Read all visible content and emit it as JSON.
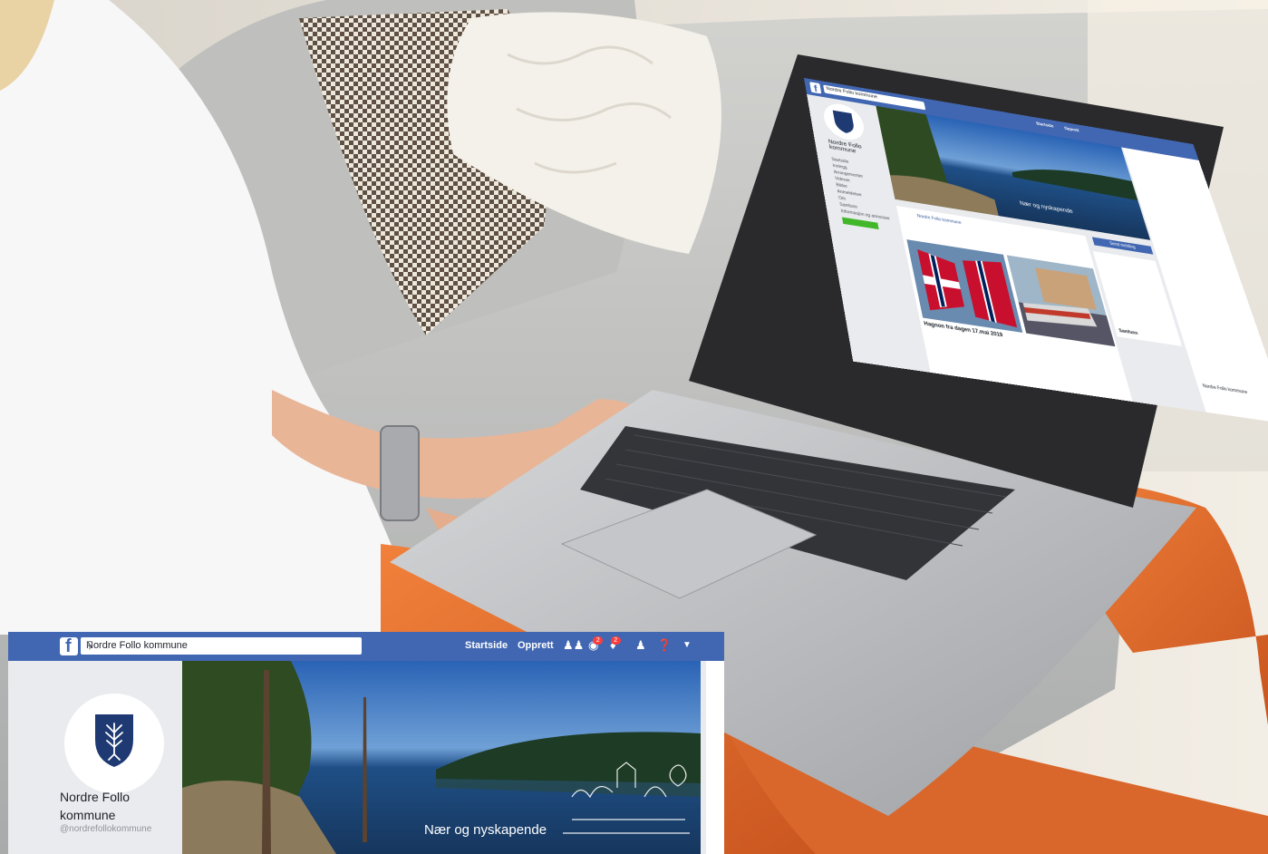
{
  "laptop_screen": {
    "search_value": "Nordre Follo kommune",
    "nav": {
      "home": "Startside",
      "create": "Opprett"
    },
    "page_name": "Nordre Follo kommune",
    "cover_text": "Nær og nyskapende",
    "sidebar_items": [
      "Startside",
      "Innlegg",
      "Arrangementer",
      "Videoer",
      "Bilder",
      "Anmeldelser",
      "Om",
      "Samfunn",
      "Informasjon og annonser"
    ],
    "post_date": "Hagnon fra dagen 17.mai 2019",
    "post_author": "Nordre Follo kommune",
    "send_message": "Send melding",
    "community_label": "Samfunn",
    "chat_name": "Nordre Follo kommune"
  },
  "inset": {
    "search_value": "Nordre Follo kommune",
    "nav": {
      "home": "Startside",
      "create": "Opprett"
    },
    "badges": {
      "messages": "2",
      "notifications": "2"
    },
    "page_name": "Nordre Follo kommune",
    "handle": "@nordrefollokommune",
    "cover_text": "Nær og nyskapende"
  },
  "colors": {
    "facebook_blue": "#4267b2",
    "sofa": "#c9c9c5",
    "pants": "#e36c2c",
    "shield": "#1f3a73"
  }
}
